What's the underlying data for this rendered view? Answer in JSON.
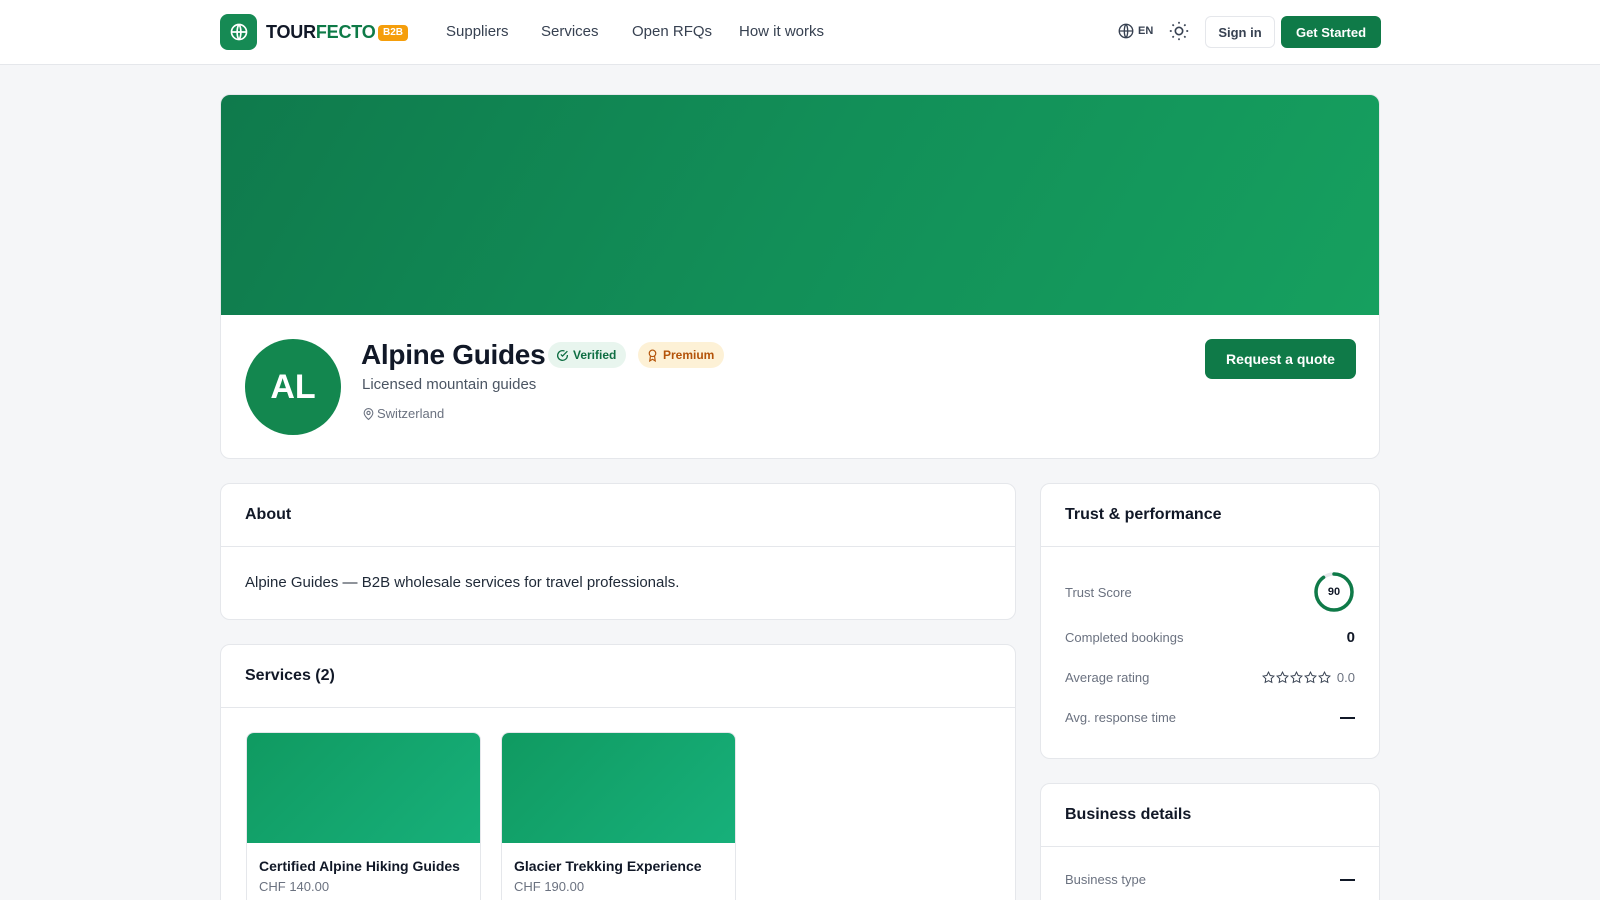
{
  "header": {
    "logo_part1": "TOUR",
    "logo_part2": "FECTO",
    "logo_badge": "B2B",
    "nav": [
      "Suppliers",
      "Services",
      "Open RFQs",
      "How it works"
    ],
    "lang": "EN",
    "sign_in": "Sign in",
    "get_started": "Get Started"
  },
  "profile": {
    "initials": "AL",
    "name": "Alpine Guides",
    "verified_label": "Verified",
    "premium_label": "Premium",
    "tagline": "Licensed mountain guides",
    "location": "Switzerland",
    "quote_button": "Request a quote"
  },
  "about": {
    "title": "About",
    "text": "Alpine Guides — B2B wholesale services for travel professionals."
  },
  "services": {
    "title": "Services (2)",
    "items": [
      {
        "title": "Certified Alpine Hiking Guides",
        "price": "CHF 140.00"
      },
      {
        "title": "Glacier Trekking Experience",
        "price": "CHF 190.00"
      }
    ]
  },
  "trust": {
    "title": "Trust & performance",
    "trust_score_label": "Trust Score",
    "trust_score": "90",
    "trust_score_fraction": 0.9,
    "completed_label": "Completed bookings",
    "completed": "0",
    "rating_label": "Average rating",
    "rating": "0.0",
    "rating_stars": 0,
    "response_label": "Avg. response time"
  },
  "business": {
    "title": "Business details",
    "type_label": "Business type"
  },
  "colors": {
    "brand": "#0f7a48",
    "premium": "#f59e0b"
  }
}
